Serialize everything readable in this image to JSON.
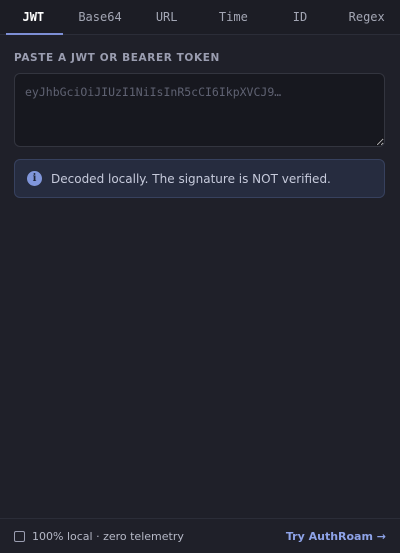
{
  "tabs": [
    {
      "label": "JWT",
      "active": true
    },
    {
      "label": "Base64",
      "active": false
    },
    {
      "label": "URL",
      "active": false
    },
    {
      "label": "Time",
      "active": false
    },
    {
      "label": "ID",
      "active": false
    },
    {
      "label": "Regex",
      "active": false
    }
  ],
  "input": {
    "label": "PASTE A JWT OR BEARER TOKEN",
    "placeholder": "eyJhbGciOiJIUzI1NiIsInR5cCI6IkpXVCJ9…",
    "value": ""
  },
  "notice": {
    "icon": "info-icon",
    "icon_glyph": "i",
    "text": "Decoded locally. The signature is NOT verified."
  },
  "footer": {
    "checkbox_checked": false,
    "text": "100% local · zero telemetry",
    "link_label": "Try AuthRoam →"
  },
  "colors": {
    "background": "#1f2029",
    "accent": "#7d8fd6",
    "notice_bg": "#262c3f",
    "link": "#8ea3e8"
  }
}
